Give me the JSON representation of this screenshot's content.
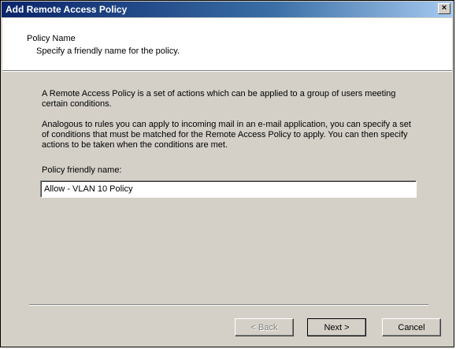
{
  "window": {
    "title": "Add Remote Access Policy",
    "close_glyph": "×"
  },
  "header": {
    "title": "Policy Name",
    "subtitle": "Specify a friendly name for the policy."
  },
  "body": {
    "paragraph1": "A Remote Access Policy is a set of actions which can be applied to a group of users meeting certain conditions.",
    "paragraph2": "Analogous to rules you can apply to incoming mail in an e-mail application, you can specify a set of conditions that must be matched for the Remote Access Policy to apply. You can then specify actions to be taken when the conditions are met."
  },
  "form": {
    "label": "Policy friendly name:",
    "value": "Allow - VLAN 10 Policy"
  },
  "buttons": {
    "back": "< Back",
    "next": "Next >",
    "cancel": "Cancel"
  },
  "colors": {
    "titlebar_start": "#0a246a",
    "titlebar_end": "#a6caf0",
    "dialog_face": "#d4d0c8"
  }
}
